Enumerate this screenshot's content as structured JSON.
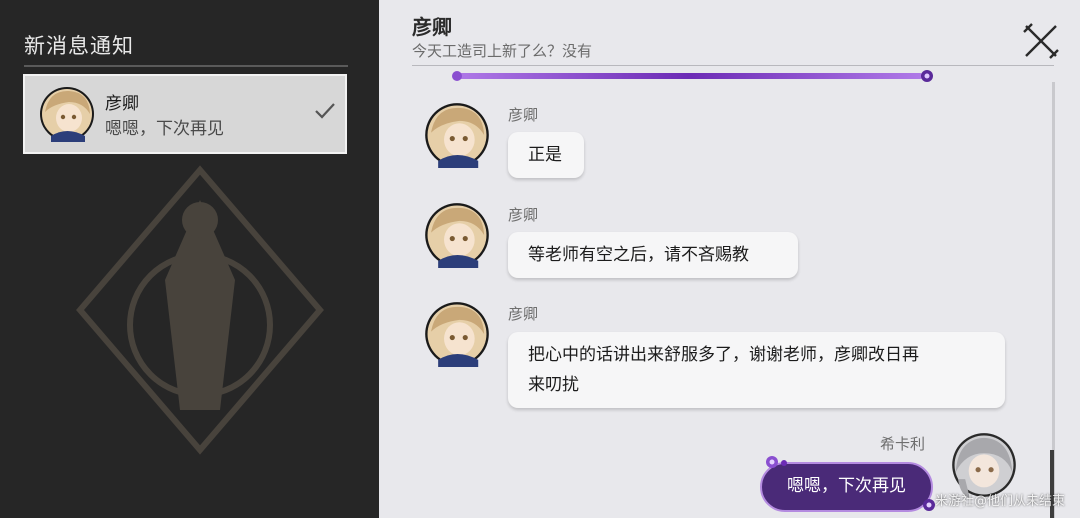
{
  "notifications_panel": {
    "title": "新消息通知",
    "conversations": [
      {
        "name": "彦卿",
        "last_message": "嗯嗯，下次再见",
        "read": true
      }
    ]
  },
  "chat": {
    "title": "彦卿",
    "subtitle": "今天工造司上新了么？没有",
    "messages": [
      {
        "sender": "彦卿",
        "side": "left",
        "text": "正是"
      },
      {
        "sender": "彦卿",
        "side": "left",
        "text": "等老师有空之后，请不吝赐教"
      },
      {
        "sender": "彦卿",
        "side": "left",
        "text_lines": [
          "把心中的话讲出来舒服多了，谢谢老师，彦卿改日再",
          "来叨扰"
        ]
      },
      {
        "sender": "希卡利",
        "side": "right",
        "text": "嗯嗯，下次再见"
      }
    ]
  },
  "watermark": "米游社@他们从未结束",
  "colors": {
    "left_panel_bg": "#262626",
    "chat_bg": "#e8e8ec",
    "self_bubble": "#4a2a78",
    "self_bubble_border": "#b48be0",
    "accent_purple": "#8a4fd0"
  },
  "icons": {
    "close": "close-x-icon",
    "read": "checkmark-icon"
  }
}
